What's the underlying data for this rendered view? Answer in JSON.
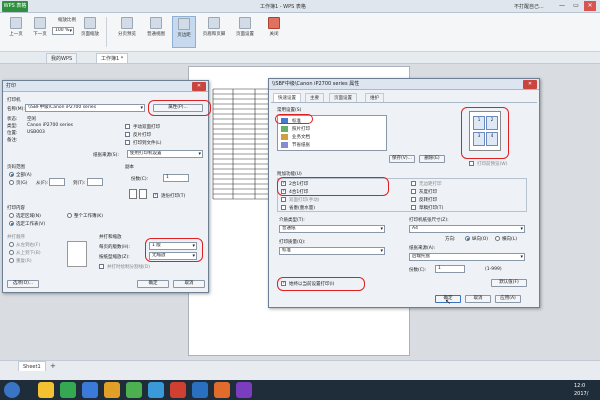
{
  "window": {
    "app_button": "WPS 表格",
    "doc_title": "工作簿1 - WPS 表格",
    "user": "不打醒自己...",
    "min": "—",
    "max": "▭",
    "close": "✕"
  },
  "ribbon": {
    "items": [
      "上一页",
      "下一页",
      "显示比例",
      "页面缩放",
      "分页预览",
      "普通视图",
      "页边距",
      "页眉和页脚",
      "页面设置",
      "关闭"
    ],
    "zoom_value": "100 %",
    "zoom_label": "缩放比例"
  },
  "tabs": [
    "我的WPS",
    "工作簿1 *"
  ],
  "print_dialog": {
    "title": "打印",
    "printer_group": "打印机",
    "name_label": "名称(M):",
    "printer_name": "\\\\SBF中级\\Canon iP2700 series",
    "properties_btn": "属性(P)...",
    "status_label": "状态:",
    "status_value": "空闲",
    "type_label": "类型:",
    "type_value": "Canon iP2700 series",
    "where_label": "位置:",
    "where_value": "USB003",
    "comment_label": "备注:",
    "manual_duplex": "手动双面打印",
    "reverse_print": "反片打印",
    "print_to_file": "打印到文件(L)",
    "paper_source_label": "纸张来源(S):",
    "paper_source_value": "使用打印机设置",
    "range_group": "页码范围",
    "range_all": "全部(A)",
    "range_pages": "页(G)",
    "from_label": "从(F):",
    "to_label": "到(T):",
    "copies_group": "副本",
    "copies_label": "份数(C):",
    "copies_value": "1",
    "collate": "逐份打印(T)",
    "content_group": "打印内容",
    "content_selection": "选定区域(N)",
    "content_sheet": "选定工作表(V)",
    "content_workbook": "整个工作簿(K)",
    "order_group": "并打顺序",
    "order_lr": "从左到右(F)",
    "order_tb": "从上到下(B)",
    "order_repeat": "重复(R)",
    "zoom_group": "并打和缩放",
    "per_sheet_label": "每页的版数(H):",
    "per_sheet_value": "1 版",
    "scale_label": "按纸型缩放(Z):",
    "scale_value": "无缩放",
    "scale_check": "并打时绘制分割线(D)",
    "options_btn": "选项(O)...",
    "ok_btn": "确定",
    "cancel_btn": "取消"
  },
  "props_dialog": {
    "title": "\\\\SBF中级\\Canon iP2700 series 属性",
    "tabs": [
      "快速设置",
      "主要",
      "页面设置",
      "维护"
    ],
    "common_label": "常用设置(S)",
    "common_items": [
      "标准",
      "照片打印",
      "业务文档",
      "节省纸张"
    ],
    "save_btn": "保存(V)...",
    "delete_btn": "删除(E)",
    "preview_check": "打印前预览(W)",
    "features_label": "附加功能(U)",
    "features": [
      "2合1打印",
      "4合1打印",
      "双面打印(手动)",
      "无边距打印",
      "灰度打印",
      "快速(速度优先)",
      "反转打印",
      "草稿打印(T)",
      "省墨(墨水量)"
    ],
    "media_label": "介质类型(T):",
    "media_value": "普通纸",
    "paper_size_label": "打印机纸张尺寸(Z):",
    "paper_size_value": "A4",
    "orientation_label": "方向:",
    "portrait": "纵向(O)",
    "landscape": "横向(L)",
    "quality_label": "打印质量(Q):",
    "quality_value": "标准",
    "source_label": "纸张来源(A):",
    "source_value": "后端托盘",
    "copies_label": "份数(C):",
    "copies_value": "1",
    "copies_range": "(1-999)",
    "always_check": "始终以当前设置打印(I)",
    "defaults_btn": "默认值(F)",
    "ok_btn": "确定",
    "cancel_btn": "取消",
    "apply_btn": "应用(A)",
    "help_btn": "帮助"
  },
  "sheet": {
    "tab": "Sheet1",
    "add": "+"
  },
  "taskbar": {
    "time": "12:0",
    "date": "2017/"
  }
}
